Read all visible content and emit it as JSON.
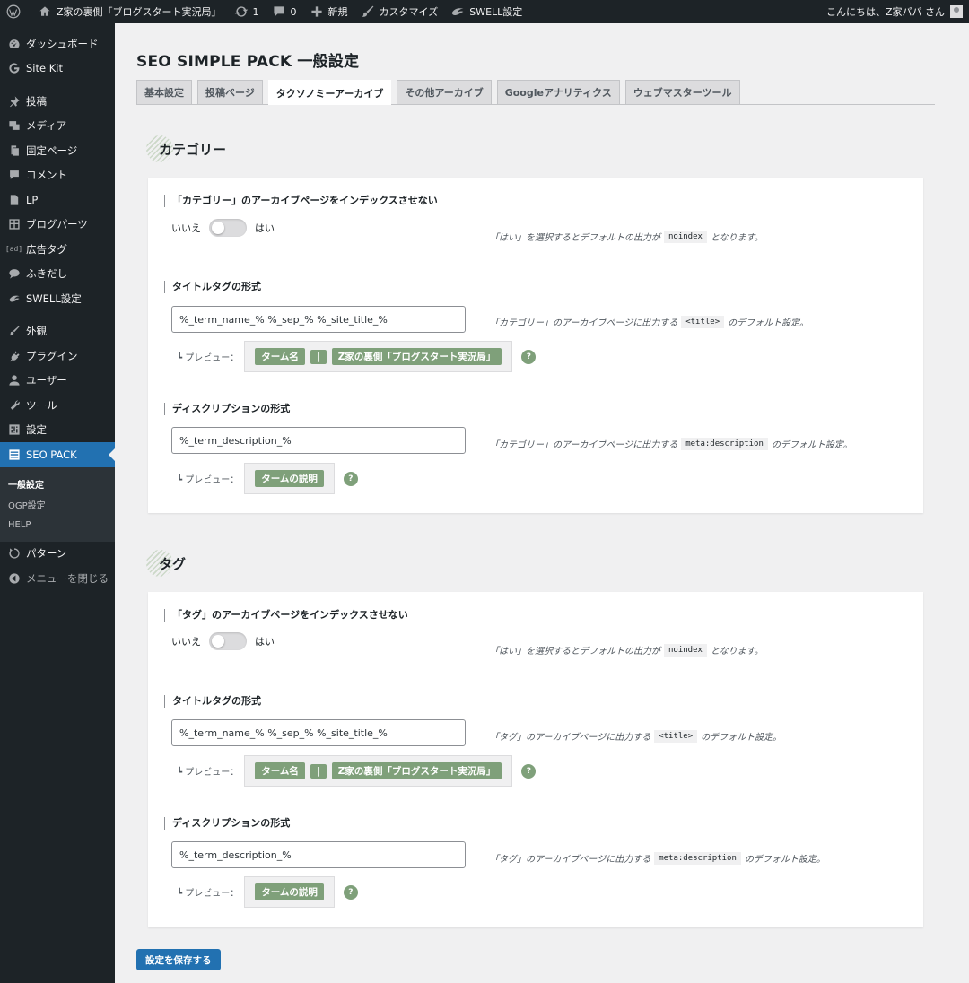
{
  "adminbar": {
    "site_name": "Z家の裏側「ブログスタート実況局」",
    "updates": "1",
    "comments": "0",
    "new": "新規",
    "customize": "カスタマイズ",
    "swell": "SWELL設定",
    "greeting": "こんにちは、Z家パパ さん"
  },
  "sidebar": {
    "items": [
      {
        "label": "ダッシュボード",
        "icon": "dashboard-icon"
      },
      {
        "label": "Site Kit",
        "icon": "google-icon"
      },
      {
        "label": "投稿",
        "icon": "pin-icon"
      },
      {
        "label": "メディア",
        "icon": "media-icon"
      },
      {
        "label": "固定ページ",
        "icon": "page-icon"
      },
      {
        "label": "コメント",
        "icon": "comment-icon"
      },
      {
        "label": "LP",
        "icon": "page-icon"
      },
      {
        "label": "ブログパーツ",
        "icon": "grid-icon"
      },
      {
        "label": "広告タグ",
        "icon": "ad-icon",
        "icon_text": "[ad]"
      },
      {
        "label": "ふきだし",
        "icon": "balloon-icon"
      },
      {
        "label": "SWELL設定",
        "icon": "swell-icon"
      },
      {
        "label": "外観",
        "icon": "brush-icon"
      },
      {
        "label": "プラグイン",
        "icon": "plugin-icon"
      },
      {
        "label": "ユーザー",
        "icon": "user-icon"
      },
      {
        "label": "ツール",
        "icon": "wrench-icon"
      },
      {
        "label": "設定",
        "icon": "settings-icon"
      },
      {
        "label": "SEO PACK",
        "icon": "seo-pack-icon"
      }
    ],
    "submenu": [
      "一般設定",
      "OGP設定",
      "HELP"
    ],
    "after": [
      {
        "label": "パターン",
        "icon": "pattern-icon"
      },
      {
        "label": "メニューを閉じる",
        "icon": "collapse-icon"
      }
    ]
  },
  "page": {
    "title": "SEO SIMPLE PACK 一般設定",
    "tabs": [
      "基本設定",
      "投稿ページ",
      "タクソノミーアーカイブ",
      "その他アーカイブ",
      "Googleアナリティクス",
      "ウェブマスターツール"
    ],
    "active_tab": 2,
    "save_label": "設定を保存する"
  },
  "sections": [
    {
      "title": "カテゴリー",
      "noindex_label": "「カテゴリー」のアーカイブページをインデックスさせない",
      "no": "いいえ",
      "yes": "はい",
      "noindex_desc_pre": "「はい」を選択するとデフォルトの出力が",
      "noindex_code": "noindex",
      "noindex_desc_post": "となります。",
      "title_label": "タイトルタグの形式",
      "title_value": "%_term_name_% %_sep_% %_site_title_%",
      "title_desc_pre": "「カテゴリー」のアーカイブページに出力する",
      "title_code": "<title>",
      "title_desc_post": "のデフォルト設定。",
      "preview_label": "┗ プレビュー：",
      "title_preview": [
        "ターム名",
        "|",
        "Z家の裏側「ブログスタート実況局」"
      ],
      "desc_label": "ディスクリプションの形式",
      "desc_value": "%_term_description_%",
      "desc_desc_pre": "「カテゴリー」のアーカイブページに出力する",
      "desc_code": "meta:description",
      "desc_desc_post": "のデフォルト設定。",
      "desc_preview": "タームの説明",
      "help": "?"
    },
    {
      "title": "タグ",
      "noindex_label": "「タグ」のアーカイブページをインデックスさせない",
      "no": "いいえ",
      "yes": "はい",
      "noindex_desc_pre": "「はい」を選択するとデフォルトの出力が",
      "noindex_code": "noindex",
      "noindex_desc_post": "となります。",
      "title_label": "タイトルタグの形式",
      "title_value": "%_term_name_% %_sep_% %_site_title_%",
      "title_desc_pre": "「タグ」のアーカイブページに出力する",
      "title_code": "<title>",
      "title_desc_post": "のデフォルト設定。",
      "preview_label": "┗ プレビュー：",
      "title_preview": [
        "ターム名",
        "|",
        "Z家の裏側「ブログスタート実況局」"
      ],
      "desc_label": "ディスクリプションの形式",
      "desc_value": "%_term_description_%",
      "desc_desc_pre": "「タグ」のアーカイブページに出力する",
      "desc_code": "meta:description",
      "desc_desc_post": "のデフォルト設定。",
      "desc_preview": "タームの説明",
      "help": "?"
    }
  ],
  "colors": {
    "admin_dark": "#1d2327",
    "accent": "#2271b1",
    "chip_green": "#7fa07a"
  }
}
